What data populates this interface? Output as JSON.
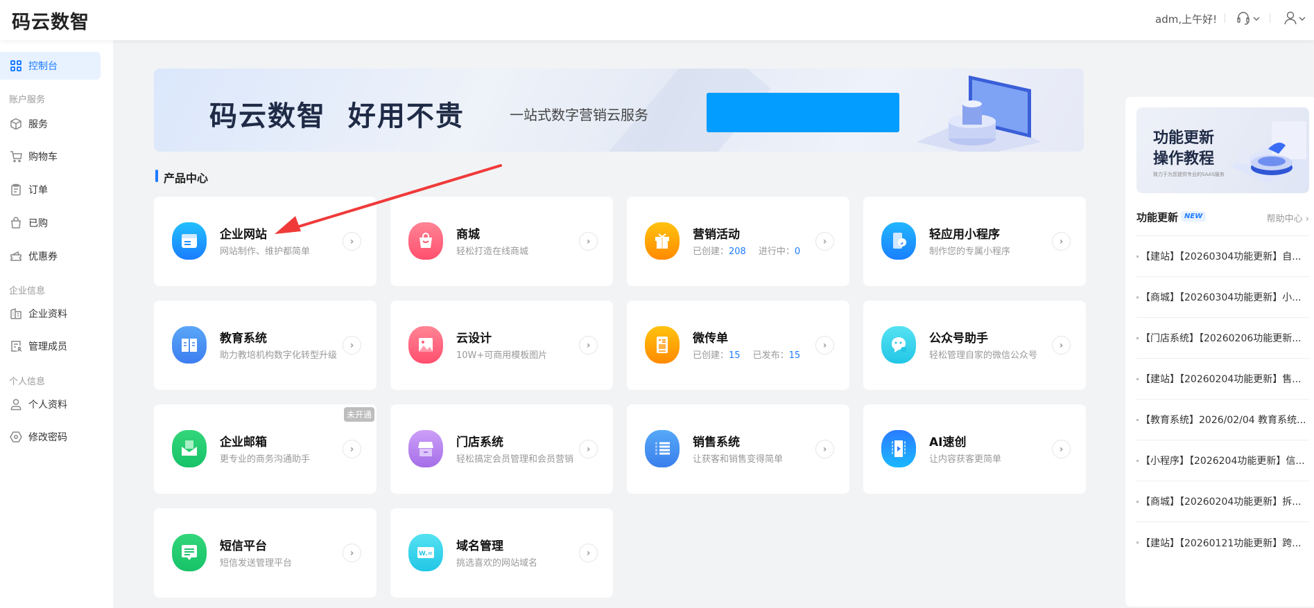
{
  "header": {
    "logo": "码云数智",
    "greeting": "adm,上午好!"
  },
  "sidebar": {
    "active": {
      "label": "控制台",
      "icon": "grid-icon"
    },
    "groups": [
      {
        "label": "账户服务",
        "items": [
          {
            "label": "服务",
            "icon": "box-icon"
          },
          {
            "label": "购物车",
            "icon": "cart-icon"
          },
          {
            "label": "订单",
            "icon": "clipboard-icon"
          },
          {
            "label": "已购",
            "icon": "bag-icon"
          },
          {
            "label": "优惠券",
            "icon": "coupon-icon"
          }
        ]
      },
      {
        "label": "企业信息",
        "items": [
          {
            "label": "企业资料",
            "icon": "building-icon"
          },
          {
            "label": "管理成员",
            "icon": "members-icon"
          }
        ]
      },
      {
        "label": "个人信息",
        "items": [
          {
            "label": "个人资料",
            "icon": "user-icon"
          },
          {
            "label": "修改密码",
            "icon": "password-icon"
          }
        ]
      }
    ]
  },
  "banner": {
    "title": "码云数智  好用不贵",
    "subtitle": "一站式数字营销云服务"
  },
  "products": {
    "title": "产品中心",
    "cards": [
      {
        "title": "企业网站",
        "desc": "网站制作、维护都简单",
        "color": [
          "#22c0ff",
          "#1a7dff"
        ]
      },
      {
        "title": "商城",
        "desc": "轻松打造在线商城",
        "color": [
          "#ff8595",
          "#ff4f6e"
        ]
      },
      {
        "title": "营销活动",
        "stats": [
          {
            "label": "已创建：",
            "value": "208"
          },
          {
            "label": "进行中：",
            "value": "0"
          }
        ],
        "color": [
          "#ffc20e",
          "#ff8a00"
        ]
      },
      {
        "title": "轻应用小程序",
        "desc": "制作您的专属小程序",
        "color": [
          "#22b6ff",
          "#1a80ff"
        ]
      },
      {
        "title": "教育系统",
        "desc": "助力教培机构数字化转型升级",
        "color": [
          "#5aa6f7",
          "#3d7ef0"
        ]
      },
      {
        "title": "云设计",
        "desc": "10W+可商用模板图片",
        "color": [
          "#ff8595",
          "#ff4f6e"
        ]
      },
      {
        "title": "微传单",
        "stats": [
          {
            "label": "已创建：",
            "value": "15"
          },
          {
            "label": "已发布：",
            "value": "15"
          }
        ],
        "color": [
          "#ffc20e",
          "#ff8a00"
        ]
      },
      {
        "title": "公众号助手",
        "desc": "轻松管理自家的微信公众号",
        "color": [
          "#55e2f2",
          "#22c6e6"
        ]
      },
      {
        "title": "企业邮箱",
        "desc": "更专业的商务沟通助手",
        "badge": "未开通",
        "color": [
          "#33d67a",
          "#17c268"
        ]
      },
      {
        "title": "门店系统",
        "desc": "轻松搞定会员管理和会员营销",
        "color": [
          "#cc9ff8",
          "#a56ee8"
        ]
      },
      {
        "title": "销售系统",
        "desc": "让获客和销售变得简单",
        "color": [
          "#56a8f8",
          "#3a7fec"
        ]
      },
      {
        "title": "AI速创",
        "desc": "让内容获客更简单",
        "color": [
          "#2a7cff",
          "#1ab8ff"
        ]
      },
      {
        "title": "短信平台",
        "desc": "短信发送管理平台",
        "color": [
          "#33d67a",
          "#17c268"
        ]
      },
      {
        "title": "域名管理",
        "desc": "挑选喜欢的网站域名",
        "color": [
          "#55e2f2",
          "#22c6e6"
        ]
      }
    ]
  },
  "updates": {
    "banner_title_1": "功能更新",
    "banner_title_2": "操作教程",
    "banner_sub": "致力于为您提供专业的SAAS服务",
    "heading": "功能更新",
    "new_badge": "NEW",
    "help": "帮助中心 ›",
    "items": [
      "【建站】【20260304功能更新】自...",
      "【商城】【20260304功能更新】小...",
      "【门店系统】【20260206功能更新...",
      "【建站】【20260204功能更新】售...",
      "【教育系统】2026/02/04 教育系统...",
      "【小程序】【2026204功能更新】信...",
      "【商城】【20260204功能更新】拆...",
      "【建站】【20260121功能更新】跨..."
    ]
  },
  "accent": "#1e7bff"
}
